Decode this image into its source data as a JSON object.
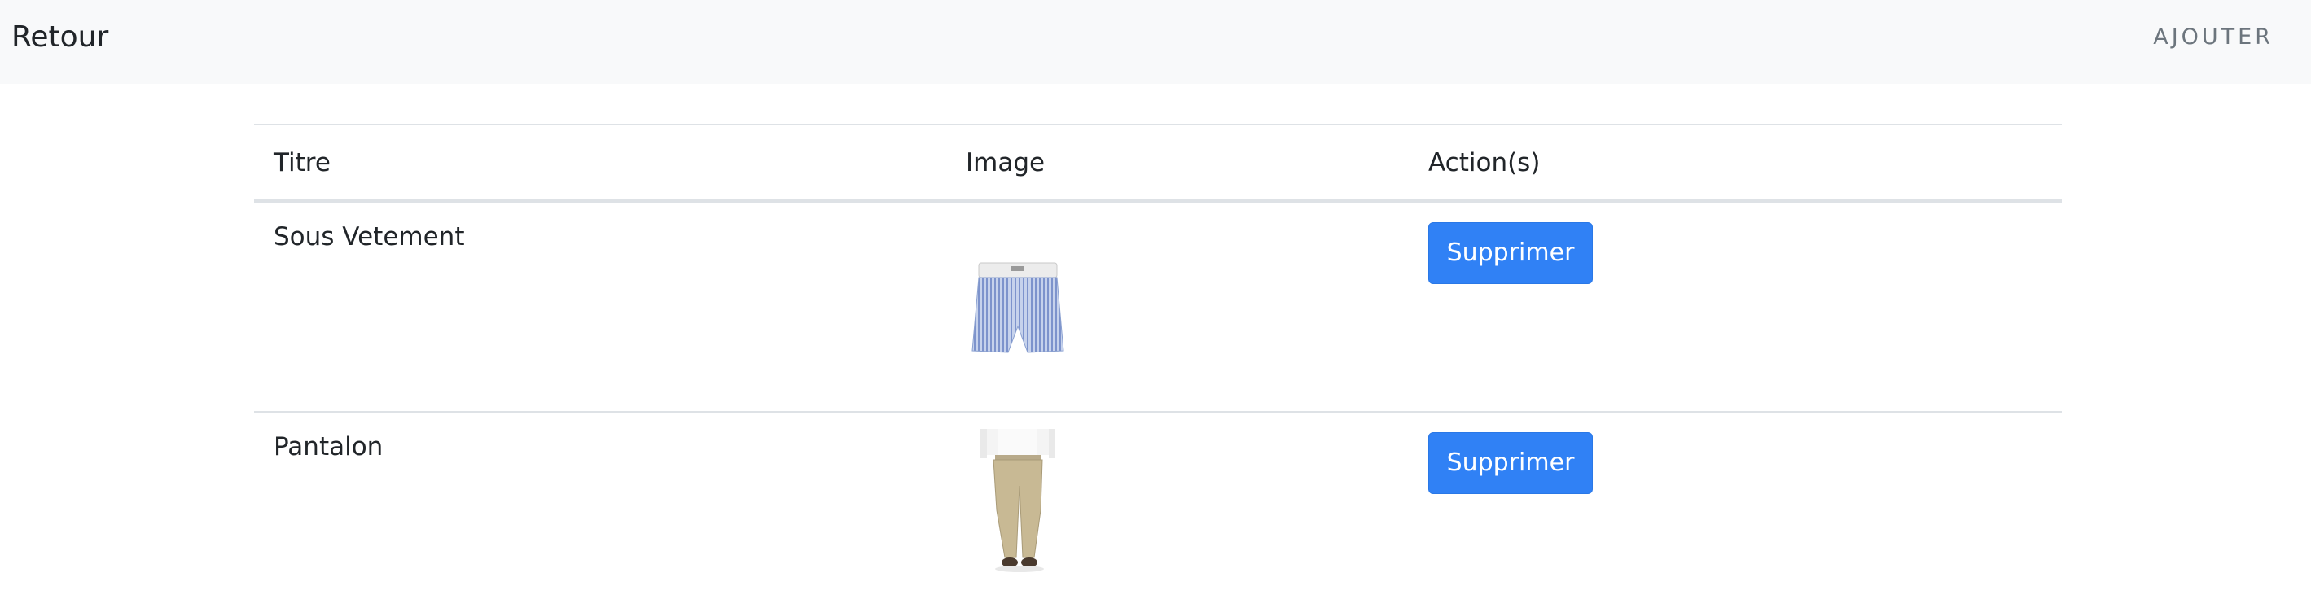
{
  "navbar": {
    "brand": "Retour",
    "add_link": "AJOUTER"
  },
  "table": {
    "headers": [
      "Titre",
      "Image",
      "Action(s)"
    ],
    "rows": [
      {
        "title": "Sous Vetement",
        "image_icon": "boxer-shorts-image",
        "action": "Supprimer"
      },
      {
        "title": "Pantalon",
        "image_icon": "trousers-image",
        "action": "Supprimer"
      }
    ]
  },
  "colors": {
    "navbar_bg": "#f8f9fa",
    "button_primary": "#3081f5",
    "border": "#dee2e6",
    "text": "#212529"
  }
}
